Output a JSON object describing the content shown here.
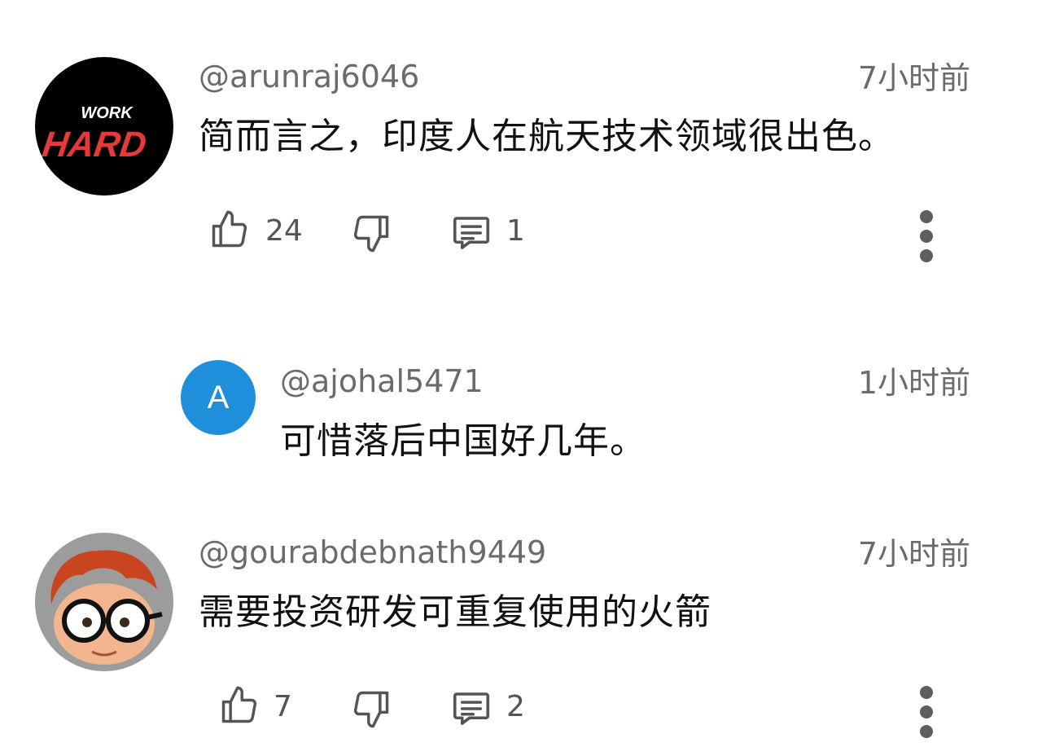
{
  "comments": [
    {
      "username": "@arunraj6046",
      "time": "7小时前",
      "text": "简而言之，印度人在航天技术领域很出色。",
      "avatar": {
        "line1": "WORK",
        "line2": "HARD",
        "bg": "#000000",
        "accent": "#e63a3a"
      },
      "likes": "24",
      "replies": "1"
    },
    {
      "username": "@ajohal5471",
      "time": "1小时前",
      "text": "可惜落后中国好几年。",
      "avatar": {
        "letter": "A",
        "bg": "#1f8fdc"
      }
    },
    {
      "username": "@gourabdebnath9449",
      "time": "7小时前",
      "text": "需要投资研发可重复使用的火箭",
      "avatar": {
        "bg": "#9c9c9c"
      },
      "likes": "7",
      "replies": "2"
    }
  ],
  "icons": {
    "like": "thumbs-up-icon",
    "dislike": "thumbs-down-icon",
    "reply": "comment-icon",
    "more": "more-vertical-icon"
  },
  "colors": {
    "meta_text": "#6b6b6b",
    "body_text": "#111111",
    "icon": "#555555"
  }
}
